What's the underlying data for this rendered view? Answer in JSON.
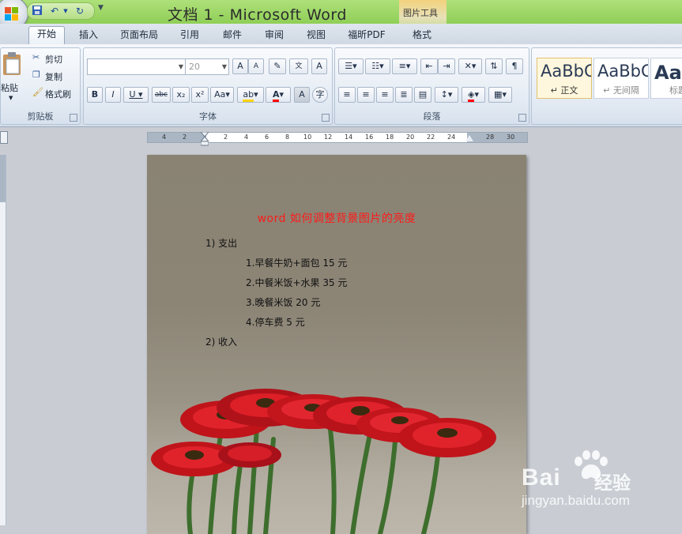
{
  "app": {
    "window_title": "文档 1 - Microsoft Word",
    "context_tab_group": "图片工具"
  },
  "quick_access": {
    "save_icon": "save-icon",
    "undo_icon": "undo-icon",
    "redo_icon": "redo-icon"
  },
  "tabs": [
    "开始",
    "插入",
    "页面布局",
    "引用",
    "邮件",
    "审阅",
    "视图",
    "福昕PDF",
    "格式"
  ],
  "active_tab": "开始",
  "ribbon": {
    "clipboard": {
      "paste": "粘贴",
      "cut": "剪切",
      "copy": "复制",
      "format_painter": "格式刷",
      "label": "剪贴板"
    },
    "font": {
      "font_name": "",
      "font_size": "20",
      "label": "字体",
      "bold": "B",
      "italic": "I",
      "underline": "U",
      "strike": "abc",
      "sub": "x₂",
      "sup": "x²",
      "change_case": "Aa",
      "font_color_letter": "A",
      "grow": "A",
      "shrink": "A"
    },
    "paragraph": {
      "label": "段落"
    },
    "styles": [
      {
        "sample": "AaBbC",
        "name": "↵ 正文"
      },
      {
        "sample": "AaBbC",
        "name": "↵ 无间隔"
      },
      {
        "sample": "Aa",
        "name": "标题"
      }
    ]
  },
  "ruler": {
    "ticks": [
      "4",
      "2",
      "2",
      "4",
      "6",
      "8",
      "10",
      "12",
      "14",
      "16",
      "18",
      "20",
      "22",
      "24",
      "28",
      "30"
    ]
  },
  "document": {
    "title": "word 如何调整背景图片的亮度",
    "lines": [
      "1) 支出",
      "1.早餐牛奶+面包 15 元",
      "2.中餐米饭+水果 35 元",
      "3.晚餐米饭 20 元",
      "4.停车费 5 元",
      "2) 收入"
    ]
  },
  "colors": {
    "title_bar": "#8fcf57",
    "doc_title": "#ff1a1a",
    "page_bg": "#8f8878"
  },
  "watermark": {
    "brand": "Bai",
    "brand_cn": "经验",
    "url": "jingyan.baidu.com"
  }
}
